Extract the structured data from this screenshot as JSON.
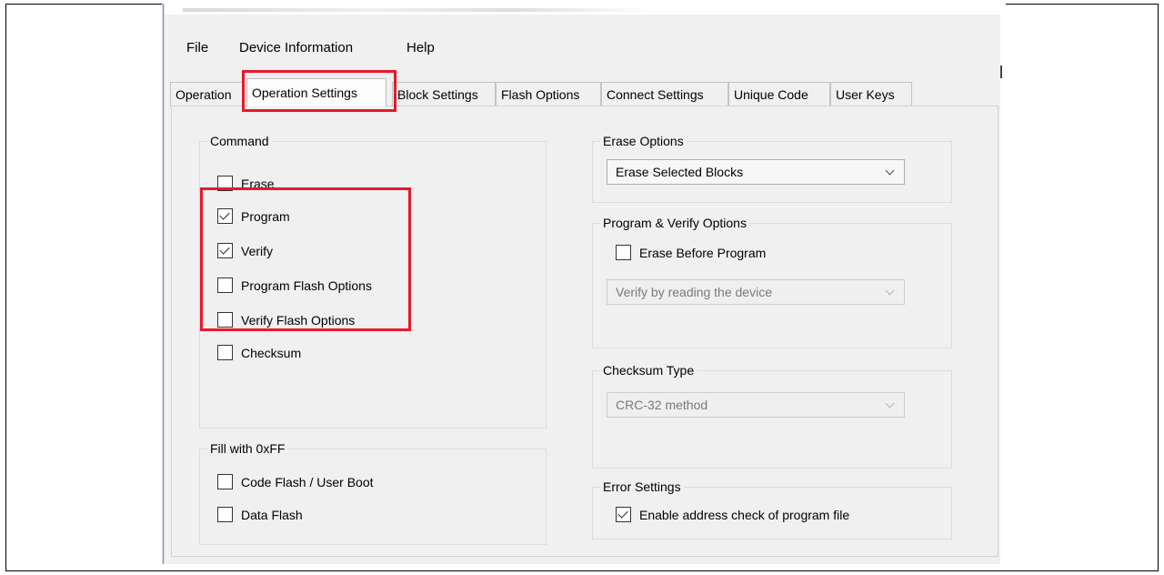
{
  "menu": {
    "file": "File",
    "device_information": "Device Information",
    "help": "Help"
  },
  "tabs": [
    {
      "label": "Operation",
      "active": false
    },
    {
      "label": "Operation Settings",
      "active": true
    },
    {
      "label": "Block Settings",
      "active": false
    },
    {
      "label": "Flash Options",
      "active": false
    },
    {
      "label": "Connect Settings",
      "active": false
    },
    {
      "label": "Unique Code",
      "active": false
    },
    {
      "label": "User Keys",
      "active": false
    }
  ],
  "command": {
    "title": "Command",
    "items": [
      {
        "label": "Erase",
        "checked": false
      },
      {
        "label": "Program",
        "checked": true
      },
      {
        "label": "Verify",
        "checked": true
      },
      {
        "label": "Program Flash Options",
        "checked": false
      },
      {
        "label": "Verify Flash Options",
        "checked": false
      },
      {
        "label": "Checksum",
        "checked": false
      }
    ]
  },
  "fill": {
    "title": "Fill with 0xFF",
    "items": [
      {
        "label": "Code Flash / User Boot",
        "checked": false
      },
      {
        "label": "Data Flash",
        "checked": false
      }
    ]
  },
  "erase_options": {
    "title": "Erase Options",
    "selected": "Erase Selected Blocks"
  },
  "program_verify": {
    "title": "Program & Verify Options",
    "erase_before_program": {
      "label": "Erase Before Program",
      "checked": false
    },
    "verify_selected": "Verify by reading the device"
  },
  "checksum_type": {
    "title": "Checksum Type",
    "selected": "CRC-32 method"
  },
  "error_settings": {
    "title": "Error Settings",
    "enable_address_check": {
      "label": "Enable address check of program file",
      "checked": true
    }
  },
  "colors": {
    "highlight": "#e8192b",
    "panel_bg": "#f0f0f0"
  }
}
